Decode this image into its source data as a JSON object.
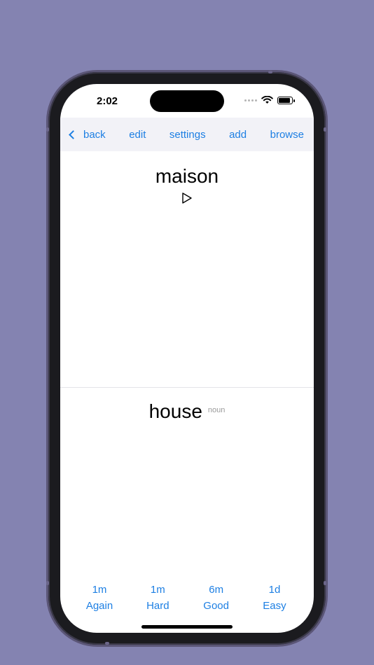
{
  "status": {
    "time": "2:02"
  },
  "nav": {
    "back": "back",
    "edit": "edit",
    "settings": "settings",
    "add": "add",
    "browse": "browse"
  },
  "card": {
    "front": "maison",
    "back": "house",
    "part_of_speech": "noun"
  },
  "answers": [
    {
      "interval": "1m",
      "label": "Again"
    },
    {
      "interval": "1m",
      "label": "Hard"
    },
    {
      "interval": "6m",
      "label": "Good"
    },
    {
      "interval": "1d",
      "label": "Easy"
    }
  ],
  "colors": {
    "background": "#8483b1",
    "accent": "#1d7fe3",
    "navbar": "#f2f2f7"
  },
  "icons": {
    "back": "chevron-left-icon",
    "play": "play-icon",
    "wifi": "wifi-icon",
    "battery": "battery-icon"
  }
}
